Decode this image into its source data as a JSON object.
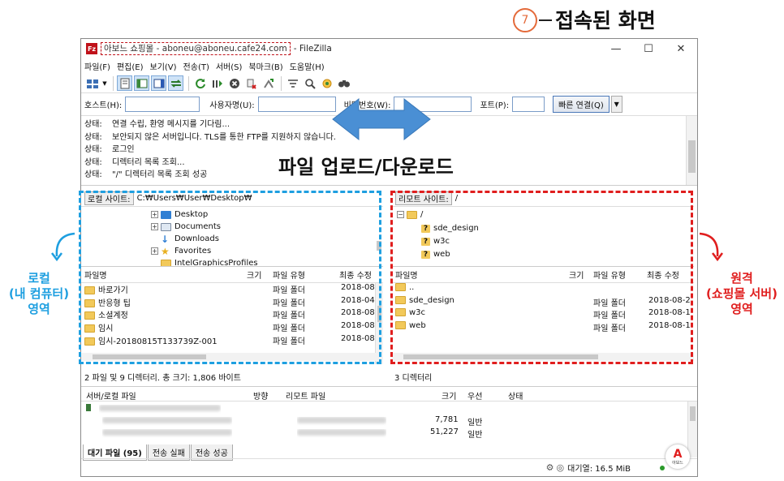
{
  "annotation": {
    "step_number": "7",
    "step_title": "접속된 화면",
    "updown_label": "파일 업로드/다운로드",
    "local_caption": [
      "로컬",
      "(내 컴퓨터)",
      "영역"
    ],
    "remote_caption": [
      "원격",
      "(쇼핑몰 서버)",
      "영역"
    ],
    "colors": {
      "local": "#1e9fe0",
      "remote": "#e01e1e",
      "step": "#e46a3a",
      "arrow": "#4a8fd4"
    }
  },
  "window": {
    "site_title": "아보느 쇼핑몰 - aboneu@aboneu.cafe24.com",
    "app_title": "- FileZilla",
    "app_icon_letter": "Fz",
    "controls": [
      "—",
      "☐",
      "✕"
    ]
  },
  "menu": [
    "파일(F)",
    "편집(E)",
    "보기(V)",
    "전송(T)",
    "서버(S)",
    "북마크(B)",
    "도움말(H)"
  ],
  "quickconnect": {
    "host_label": "호스트(H):",
    "user_label": "사용자명(U):",
    "pass_label": "비밀번호(W):",
    "port_label": "포트(P):",
    "connect_label": "빠른 연결(Q)",
    "host_value": "",
    "user_value": "",
    "pass_value": "",
    "port_value": ""
  },
  "log": [
    {
      "label": "상태:",
      "text": "연결 수립, 환영 메시지를 기다림..."
    },
    {
      "label": "상태:",
      "text": "보안되지 않은 서버입니다. TLS를 통한 FTP를 지원하지 않습니다."
    },
    {
      "label": "상태:",
      "text": "로그인"
    },
    {
      "label": "상태:",
      "text": "디렉터리 목록 조회..."
    },
    {
      "label": "상태:",
      "text": "\"/\" 디렉터리 목록 조회 성공"
    }
  ],
  "local": {
    "site_label": "로컬 사이트:",
    "path": "C:₩Users₩User₩Desktop₩",
    "tree": [
      "Desktop",
      "Documents",
      "Downloads",
      "Favorites",
      "IntelGraphicsProfiles"
    ],
    "columns": [
      "파일명",
      "크기",
      "파일 유형",
      "최종 수정"
    ],
    "files": [
      {
        "name": "바로가기",
        "size": "",
        "type": "파일 폴더",
        "modified": "2018-08"
      },
      {
        "name": "반응형 팁",
        "size": "",
        "type": "파일 폴더",
        "modified": "2018-04"
      },
      {
        "name": "소셜계정",
        "size": "",
        "type": "파일 폴더",
        "modified": "2018-08"
      },
      {
        "name": "임시",
        "size": "",
        "type": "파일 폴더",
        "modified": "2018-08"
      },
      {
        "name": "임시-20180815T133739Z-001",
        "size": "",
        "type": "파일 폴더",
        "modified": "2018-08"
      }
    ],
    "status": "2 파일 및 9 디렉터리. 총 크기: 1,806 바이트"
  },
  "remote": {
    "site_label": "리모트 사이트:",
    "path": "/",
    "tree_root": "/",
    "tree": [
      "sde_design",
      "w3c",
      "web"
    ],
    "columns": [
      "파일명",
      "크기",
      "파일 유형",
      "최종 수정"
    ],
    "files": [
      {
        "name": "..",
        "size": "",
        "type": "",
        "modified": ""
      },
      {
        "name": "sde_design",
        "size": "",
        "type": "파일 폴더",
        "modified": "2018-08-2"
      },
      {
        "name": "w3c",
        "size": "",
        "type": "파일 폴더",
        "modified": "2018-08-1"
      },
      {
        "name": "web",
        "size": "",
        "type": "파일 폴더",
        "modified": "2018-08-1"
      }
    ],
    "status": "3 디렉터리"
  },
  "queue": {
    "columns": [
      "서버/로컬 파일",
      "방향",
      "리모트 파일",
      "크기",
      "우선",
      "상태"
    ],
    "rows": [
      {
        "size": "",
        "priority": ""
      },
      {
        "size": "7,781",
        "priority": "일반"
      },
      {
        "size": "51,227",
        "priority": "일반"
      }
    ],
    "tabs": [
      "대기 파일 (95)",
      "전송 실패",
      "전송 성공"
    ]
  },
  "statusbar": {
    "queue_label": "대기열: 16.5 MiB"
  },
  "logo": {
    "text": "아보느"
  }
}
